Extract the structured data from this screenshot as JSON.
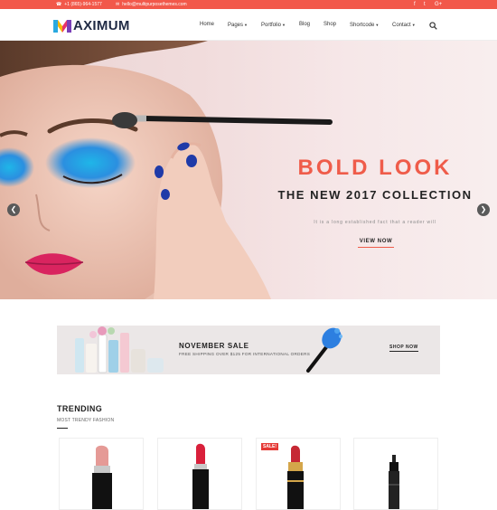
{
  "topbar": {
    "phone": "+1 (865)-964-1577",
    "email": "hello@multipurposethemes.com",
    "social": [
      "f",
      "t",
      "G+"
    ],
    "bg_color": "#f2584a"
  },
  "header": {
    "logo_text": "AXIMUM",
    "nav": [
      {
        "label": "Home",
        "dropdown": false
      },
      {
        "label": "Pages",
        "dropdown": true
      },
      {
        "label": "Portfolio",
        "dropdown": true
      },
      {
        "label": "Blog",
        "dropdown": false
      },
      {
        "label": "Shop",
        "dropdown": false
      },
      {
        "label": "Shortcode",
        "dropdown": true
      },
      {
        "label": "Contact",
        "dropdown": true
      }
    ],
    "search_icon": "search-icon"
  },
  "hero": {
    "title": "BOLD LOOK",
    "subtitle": "THE NEW 2017 COLLECTION",
    "description": "It is a long established fact that a reader will",
    "button": "VIEW NOW",
    "accent_color": "#ef5c4a",
    "prev_icon": "chevron-left-icon",
    "next_icon": "chevron-right-icon"
  },
  "banner": {
    "title": "NOVEMBER SALE",
    "subtitle": "FREE SHIPPING OVER $125 FOR INTERNATIONAL ORDERS",
    "button": "SHOP NOW"
  },
  "trending": {
    "title": "TRENDING",
    "subtitle": "MOST TRENDY FASHION",
    "products": [
      {
        "badge": ""
      },
      {
        "badge": ""
      },
      {
        "badge": "SALE!"
      },
      {
        "badge": ""
      }
    ]
  }
}
